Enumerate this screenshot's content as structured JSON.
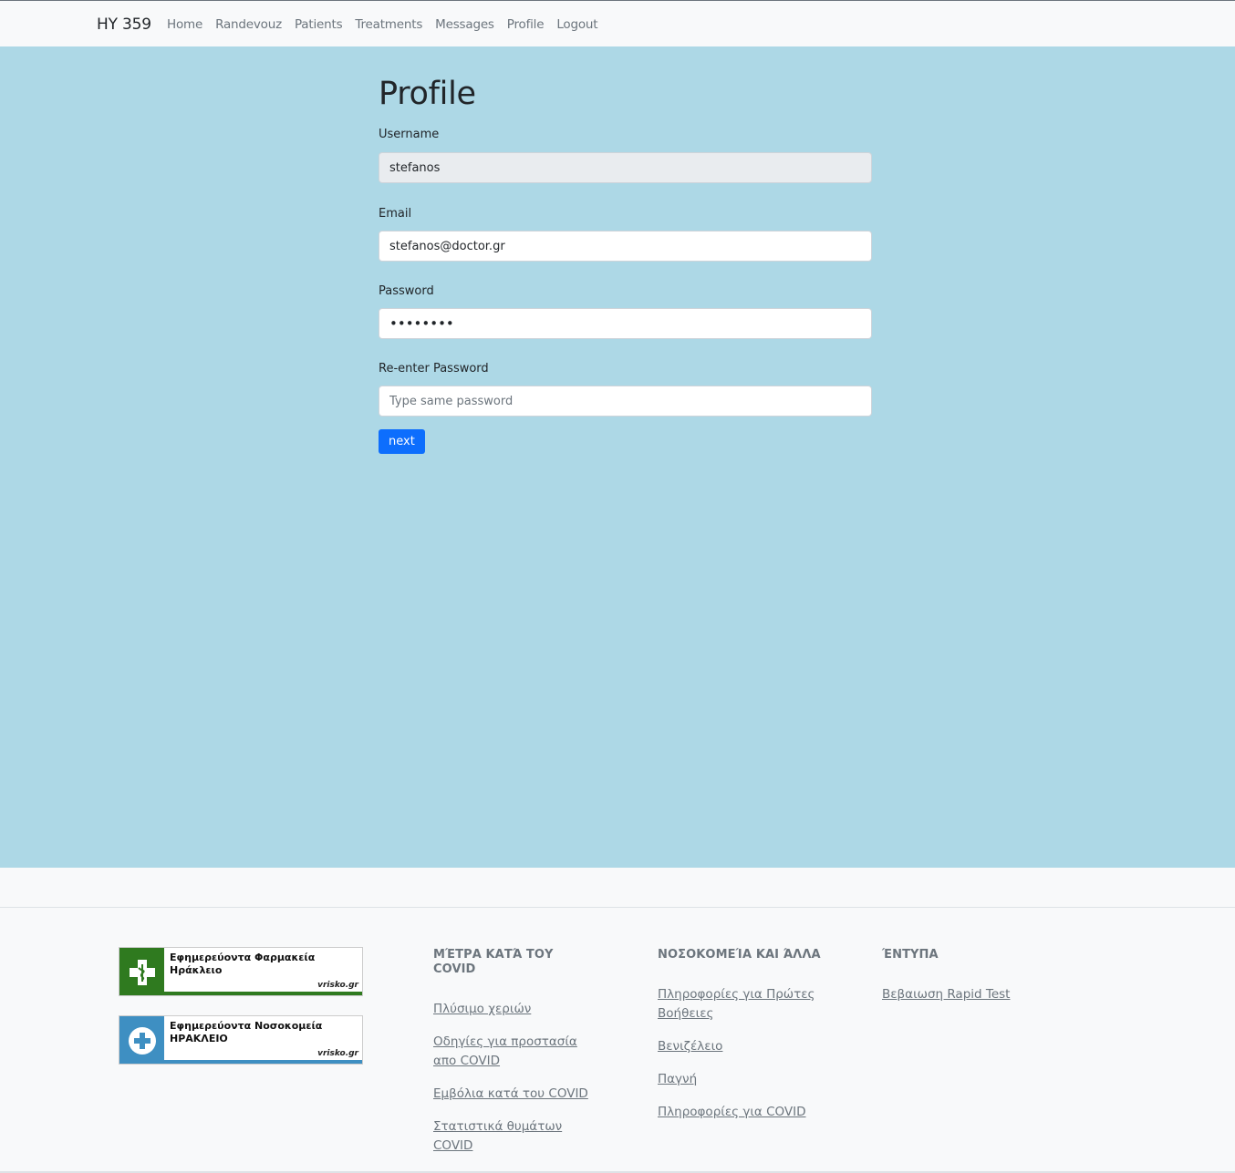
{
  "navbar": {
    "brand": "HY 359",
    "links": [
      "Home",
      "Randevouz",
      "Patients",
      "Treatments",
      "Messages",
      "Profile",
      "Logout"
    ]
  },
  "form": {
    "title": "Profile",
    "username_label": "Username",
    "username_value": "stefanos",
    "email_label": "Email",
    "email_value": "stefanos@doctor.gr",
    "password_label": "Password",
    "password_value": "••••••••",
    "reenter_label": "Re-enter Password",
    "reenter_placeholder": "Type same password",
    "next_label": "next"
  },
  "footer": {
    "banner_pharmacy": {
      "line1": "Εφημερεύοντα Φαρμακεία",
      "line2": "Ηράκλειο",
      "logo": "vrisko.gr",
      "icon": "pharmacy-cross-icon",
      "color": "#2f7a1f"
    },
    "banner_hospital": {
      "line1": "Εφημερεύοντα Νοσοκομεία",
      "line2": "ΗΡΑΚΛΕΙΟ",
      "logo": "vrisko.gr",
      "icon": "medical-cross-icon",
      "color": "#3e8fc2"
    },
    "col1": {
      "heading": "ΜΈΤΡΑ ΚΑΤΆ ΤΟΥ COVID",
      "links": [
        "Πλύσιμο χεριών",
        "Οδηγίες για προστασία απο COVID",
        "Εμβόλια κατά του COVID",
        "Στατιστικά θυμάτων COVID"
      ]
    },
    "col2": {
      "heading": "ΝΟΣΟΚΟΜΕΊΑ ΚΑΙ ΆΛΛΑ",
      "links": [
        "Πληροφορίες για Πρώτες Βοήθειες",
        "Βενιζέλειο",
        "Παγνή",
        "Πληροφορίες για COVID"
      ]
    },
    "col3": {
      "heading": "ΈΝΤΥΠΑ",
      "links": [
        "Βεβαιωση Rapid Test"
      ]
    }
  },
  "colors": {
    "main_bg": "#add8e6",
    "primary": "#0d6efd"
  }
}
